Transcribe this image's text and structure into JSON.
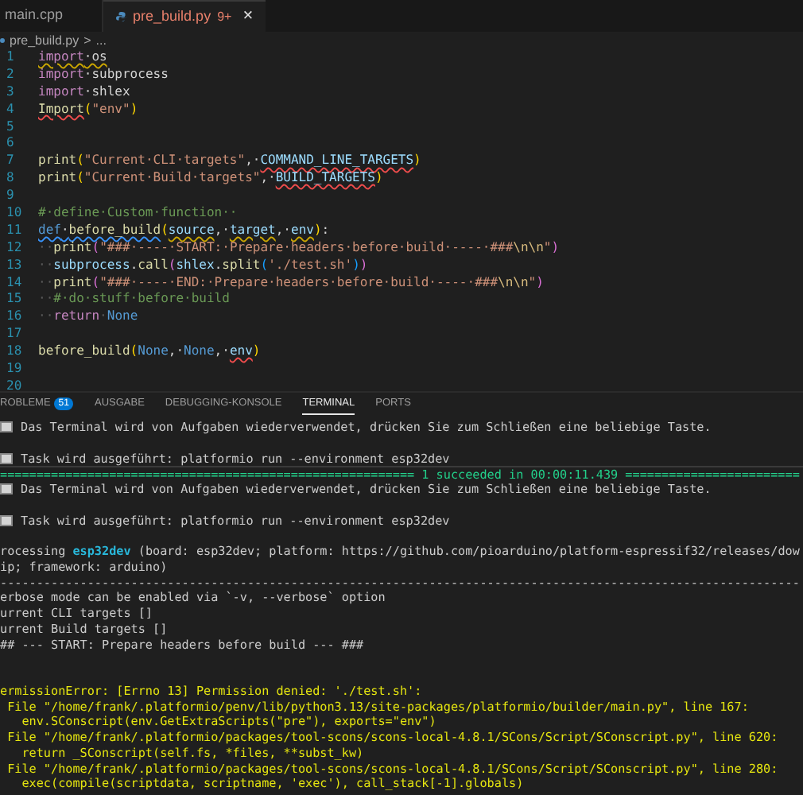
{
  "editor_tabs": [
    {
      "label": "main.cpp",
      "selected": false
    },
    {
      "label": "pre_build.py",
      "badge": "9+",
      "close": "×",
      "selected": true
    }
  ],
  "breadcrumb": {
    "file": "pre_build.py",
    "separator": ">",
    "more": "..."
  },
  "code_lines": [
    {
      "number": "1",
      "tokens": [
        {
          "kind": "kw",
          "text": "import",
          "warning": true
        },
        {
          "kind": "plain",
          "text": "·os",
          "warning": true
        }
      ]
    },
    {
      "number": "2",
      "tokens": [
        {
          "kind": "kw",
          "text": "import"
        },
        {
          "kind": "plain",
          "text": "·subprocess"
        }
      ]
    },
    {
      "number": "3",
      "tokens": [
        {
          "kind": "kw",
          "text": "import"
        },
        {
          "kind": "plain",
          "text": "·shlex"
        }
      ]
    },
    {
      "number": "4",
      "tokens": [
        {
          "kind": "fn",
          "text": "Import",
          "error": true
        },
        {
          "kind": "bracket",
          "text": "("
        },
        {
          "kind": "str",
          "text": "\"env\""
        },
        {
          "kind": "bracket",
          "text": ")"
        }
      ]
    },
    {
      "number": "5"
    },
    {
      "number": "6"
    },
    {
      "number": "7",
      "tokens": [
        {
          "kind": "fn",
          "text": "print"
        },
        {
          "kind": "bracket",
          "text": "("
        },
        {
          "kind": "str",
          "text": "\"Current·CLI·targets\""
        },
        {
          "kind": "plain",
          "text": ",·"
        },
        {
          "kind": "param",
          "text": "COMMAND_LINE_TARGETS",
          "error": true
        },
        {
          "kind": "bracket",
          "text": ")"
        }
      ]
    },
    {
      "number": "8",
      "tokens": [
        {
          "kind": "fn",
          "text": "print"
        },
        {
          "kind": "bracket",
          "text": "("
        },
        {
          "kind": "str",
          "text": "\"Current·Build·targets\""
        },
        {
          "kind": "plain",
          "text": ",·"
        },
        {
          "kind": "param",
          "text": "BUILD_TARGETS",
          "error": true
        },
        {
          "kind": "bracket",
          "text": ")"
        }
      ]
    },
    {
      "number": "9"
    },
    {
      "number": "10",
      "tokens": [
        {
          "kind": "comment",
          "text": "#·define·Custom·function··"
        }
      ]
    },
    {
      "number": "11",
      "tokens": [
        {
          "kind": "const",
          "text": "def",
          "info": true
        },
        {
          "kind": "plain",
          "text": "·",
          "info": true
        },
        {
          "kind": "fn",
          "text": "before_build",
          "info": true
        },
        {
          "kind": "bracket",
          "text": "("
        },
        {
          "kind": "param",
          "text": "source",
          "warning": true
        },
        {
          "kind": "plain",
          "text": ",·"
        },
        {
          "kind": "param",
          "text": "target",
          "warning": true
        },
        {
          "kind": "plain",
          "text": ",·"
        },
        {
          "kind": "param",
          "text": "env",
          "warning": true
        },
        {
          "kind": "bracket",
          "text": ")"
        },
        {
          "kind": "plain",
          "text": ":"
        }
      ]
    },
    {
      "number": "12",
      "tokens": [
        {
          "kind": "ws",
          "text": "··"
        },
        {
          "kind": "fn",
          "text": "print"
        },
        {
          "kind": "bracket2",
          "text": "("
        },
        {
          "kind": "str",
          "text": "\"###·----·START:·Prepare·headers·before·build·----·###"
        },
        {
          "kind": "escape",
          "text": "\\n\\n"
        },
        {
          "kind": "str",
          "text": "\""
        },
        {
          "kind": "bracket2",
          "text": ")"
        }
      ]
    },
    {
      "number": "13",
      "tokens": [
        {
          "kind": "ws",
          "text": "··"
        },
        {
          "kind": "param",
          "text": "subprocess"
        },
        {
          "kind": "plain",
          "text": "."
        },
        {
          "kind": "fn",
          "text": "call"
        },
        {
          "kind": "bracket2",
          "text": "("
        },
        {
          "kind": "param",
          "text": "shlex"
        },
        {
          "kind": "plain",
          "text": "."
        },
        {
          "kind": "fn",
          "text": "split"
        },
        {
          "kind": "bracket3",
          "text": "("
        },
        {
          "kind": "str",
          "text": "'./test.sh'"
        },
        {
          "kind": "bracket3",
          "text": ")"
        },
        {
          "kind": "bracket2",
          "text": ")"
        }
      ]
    },
    {
      "number": "14",
      "tokens": [
        {
          "kind": "ws",
          "text": "··"
        },
        {
          "kind": "fn",
          "text": "print"
        },
        {
          "kind": "bracket2",
          "text": "("
        },
        {
          "kind": "str",
          "text": "\"###·----·END:·Prepare·headers·before·build·----·###"
        },
        {
          "kind": "escape",
          "text": "\\n\\n"
        },
        {
          "kind": "str",
          "text": "\""
        },
        {
          "kind": "bracket2",
          "text": ")"
        }
      ]
    },
    {
      "number": "15",
      "tokens": [
        {
          "kind": "ws",
          "text": "··"
        },
        {
          "kind": "comment",
          "text": "#·do·stuff·before·build"
        }
      ]
    },
    {
      "number": "16",
      "tokens": [
        {
          "kind": "ws",
          "text": "··"
        },
        {
          "kind": "kw",
          "text": "return"
        },
        {
          "kind": "ws",
          "text": "·"
        },
        {
          "kind": "const",
          "text": "None"
        }
      ]
    },
    {
      "number": "17"
    },
    {
      "number": "18",
      "tokens": [
        {
          "kind": "fn",
          "text": "before_build"
        },
        {
          "kind": "bracket",
          "text": "("
        },
        {
          "kind": "const",
          "text": "None"
        },
        {
          "kind": "plain",
          "text": ",·"
        },
        {
          "kind": "const",
          "text": "None"
        },
        {
          "kind": "plain",
          "text": ",·"
        },
        {
          "kind": "param",
          "text": "env",
          "error": true
        },
        {
          "kind": "bracket",
          "text": ")"
        }
      ]
    },
    {
      "number": "19"
    },
    {
      "number": "20"
    }
  ],
  "panel_tabs": [
    {
      "label": "ROBLEME",
      "badge": "51",
      "selected": false
    },
    {
      "label": "AUSGABE",
      "selected": false
    },
    {
      "label": "DEBUGGING-KONSOLE",
      "selected": false
    },
    {
      "label": "TERMINAL",
      "selected": true
    },
    {
      "label": "PORTS",
      "selected": false
    }
  ],
  "terminal_lines": [
    {
      "kind": "task",
      "text": "Das Terminal wird von Aufgaben wiederverwendet, drücken Sie zum Schließen eine beliebige Taste."
    },
    {
      "kind": "blank"
    },
    {
      "kind": "task",
      "text": "Task wird ausgeführt: platformio run --environment esp32dev"
    },
    {
      "kind": "success",
      "left": "=========================================================",
      "text": "1 succeeded in 00:00:11.439",
      "right": "========================"
    },
    {
      "kind": "task",
      "text": "Das Terminal wird von Aufgaben wiederverwendet, drücken Sie zum Schließen eine beliebige Taste."
    },
    {
      "kind": "blank"
    },
    {
      "kind": "task",
      "text": "Task wird ausgeführt: platformio run --environment esp32dev"
    },
    {
      "kind": "blank"
    },
    {
      "kind": "segments",
      "segments": [
        {
          "kind": "plain",
          "text": "rocessing "
        },
        {
          "kind": "env",
          "text": "esp32dev"
        },
        {
          "kind": "plain",
          "text": " (board: esp32dev; platform: https://github.com/pioarduino/platform-espressif32/releases/dow"
        }
      ]
    },
    {
      "kind": "plain",
      "text": "ip; framework: arduino)"
    },
    {
      "kind": "plain",
      "text": "--------------------------------------------------------------------------------------------------------------"
    },
    {
      "kind": "plain",
      "text": "erbose mode can be enabled via `-v, --verbose` option"
    },
    {
      "kind": "plain",
      "text": "urrent CLI targets []"
    },
    {
      "kind": "plain",
      "text": "urrent Build targets []"
    },
    {
      "kind": "plain",
      "text": "## --- START: Prepare headers before build --- ###"
    },
    {
      "kind": "blank"
    },
    {
      "kind": "blank"
    },
    {
      "kind": "error",
      "text": "ermissionError: [Errno 13] Permission denied: './test.sh':"
    },
    {
      "kind": "error",
      "text": " File \"/home/frank/.platformio/penv/lib/python3.13/site-packages/platformio/builder/main.py\", line 167:"
    },
    {
      "kind": "error",
      "text": "   env.SConscript(env.GetExtraScripts(\"pre\"), exports=\"env\")"
    },
    {
      "kind": "error",
      "text": " File \"/home/frank/.platformio/packages/tool-scons/scons-local-4.8.1/SCons/Script/SConscript.py\", line 620:"
    },
    {
      "kind": "error",
      "text": "   return _SConscript(self.fs, *files, **subst_kw)"
    },
    {
      "kind": "error",
      "text": " File \"/home/frank/.platformio/packages/tool-scons/scons-local-4.8.1/SCons/Script/SConscript.py\", line 280:"
    },
    {
      "kind": "error",
      "text": "   exec(compile(scriptdata, scriptname, 'exec'), call_stack[-1].globals)"
    }
  ]
}
